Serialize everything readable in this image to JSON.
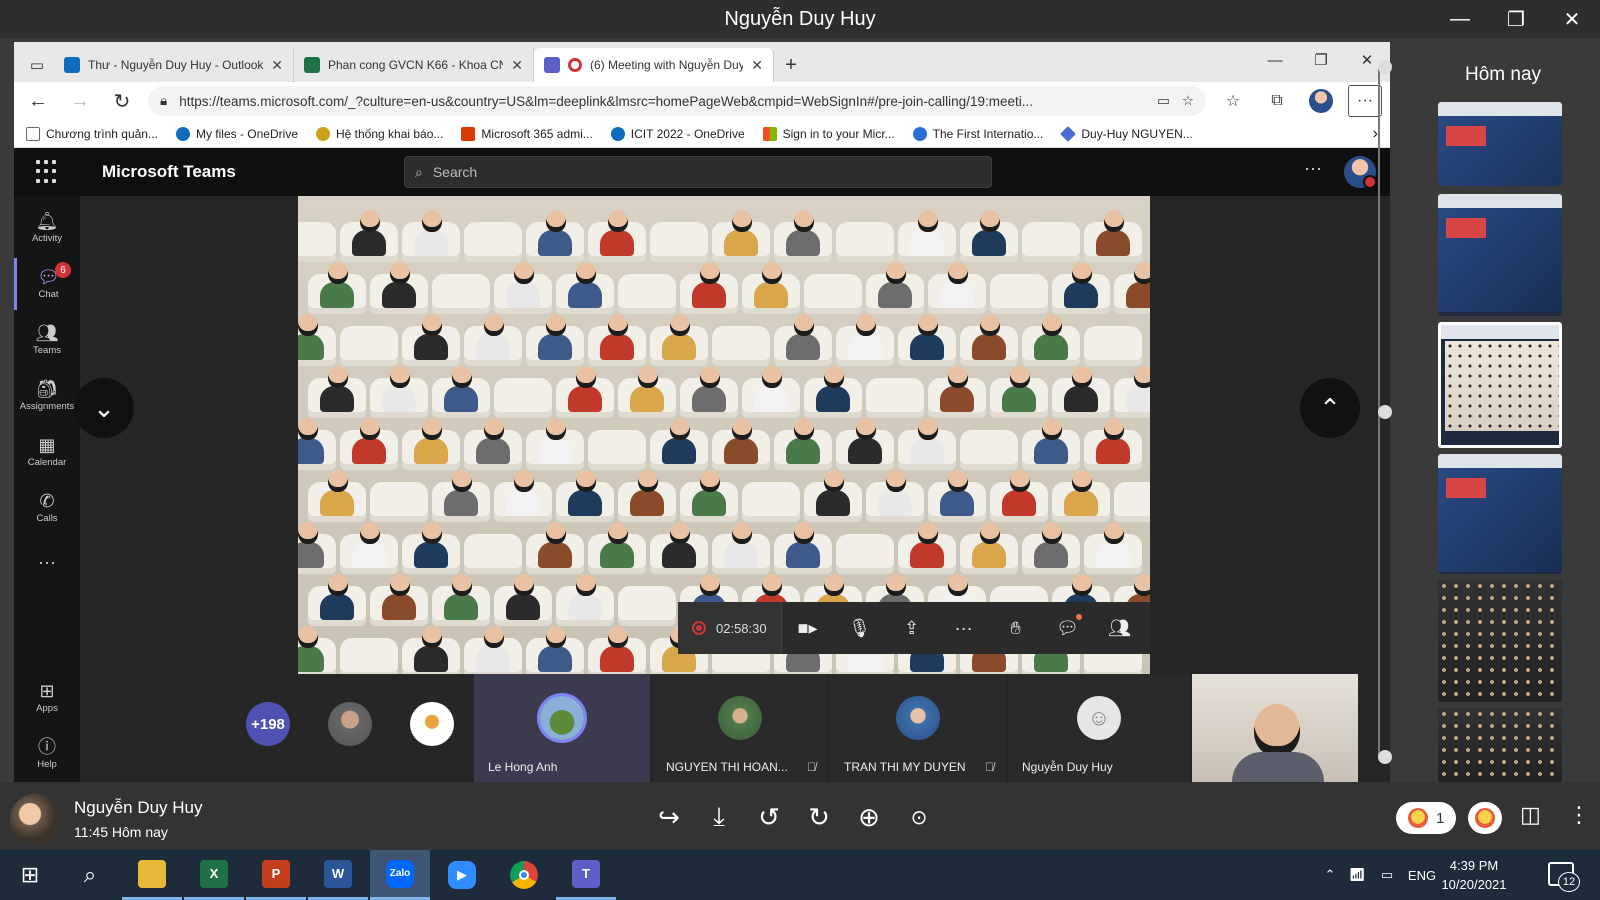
{
  "viewer": {
    "title": "Nguyễn Duy Huy",
    "controls": {
      "minimize": "—",
      "restore": "❐",
      "close": "✕"
    }
  },
  "browser": {
    "tabs": [
      {
        "label": "Thư - Nguyễn Duy Huy - Outlook",
        "icon": "outlook-icon",
        "color": "#0f6cbd"
      },
      {
        "label": "Phan cong GVCN K66 - Khoa CN",
        "icon": "excel-icon",
        "color": "#1e7145"
      },
      {
        "label": "(6) Meeting with Nguyễn Duy Huy",
        "icon": "teams-icon",
        "color": "#5b5fc7"
      }
    ],
    "url": "https://teams.microsoft.com/_?culture=en-us&country=US&lm=deeplink&lmsrc=homePageWeb&cmpid=WebSignIn#/pre-join-calling/19:meeti...",
    "bookmarks": [
      {
        "label": "Chương trình quản...",
        "color": "#666666"
      },
      {
        "label": "My files - OneDrive",
        "color": "#0f6cbd"
      },
      {
        "label": "Hệ thống khai báo...",
        "color": "#c9a21a"
      },
      {
        "label": "Microsoft 365 admi...",
        "color": "#d83b01"
      },
      {
        "label": "ICIT 2022 - OneDrive",
        "color": "#0f6cbd"
      },
      {
        "label": "Sign in to your Micr...",
        "color": "#7fba00"
      },
      {
        "label": "The First Internatio...",
        "color": "#2b6cd4"
      },
      {
        "label": "Duy-Huy NGUYEN...",
        "color": "#4a6bd8"
      }
    ]
  },
  "teams": {
    "brand": "Microsoft Teams",
    "search_placeholder": "Search",
    "rail": [
      {
        "label": "Activity",
        "icon": "bell-icon"
      },
      {
        "label": "Chat",
        "icon": "chat-icon",
        "badge": "6"
      },
      {
        "label": "Teams",
        "icon": "teams-icon"
      },
      {
        "label": "Assignments",
        "icon": "assignments-icon"
      },
      {
        "label": "Calendar",
        "icon": "calendar-icon"
      },
      {
        "label": "Calls",
        "icon": "phone-icon"
      },
      {
        "label": "Apps",
        "icon": "apps-icon"
      },
      {
        "label": "Help",
        "icon": "help-icon"
      }
    ],
    "call": {
      "timer": "02:58:30",
      "recording": true
    },
    "participants": {
      "more_count": "+198",
      "tiles": [
        {
          "name": "Le Hong Anh",
          "speaking": true,
          "muted": false
        },
        {
          "name": "NGUYEN THI HOAN...",
          "speaking": false,
          "muted": true
        },
        {
          "name": "TRAN THI MY DUYEN",
          "speaking": false,
          "muted": true
        },
        {
          "name": "Nguyễn Duy Huy",
          "speaking": false,
          "muted": false
        }
      ]
    }
  },
  "side_panel": {
    "title": "Hôm nay"
  },
  "info": {
    "sender": "Nguyễn Duy Huy",
    "time": "11:45 Hôm nay",
    "reaction_count": "1"
  },
  "taskbar": {
    "apps": [
      "File Explorer",
      "Excel",
      "PowerPoint",
      "Word",
      "Zalo",
      "Zoom",
      "Chrome",
      "Teams"
    ],
    "language": "ENG",
    "time": "4:39 PM",
    "date": "10/20/2021",
    "notifications": "12"
  }
}
